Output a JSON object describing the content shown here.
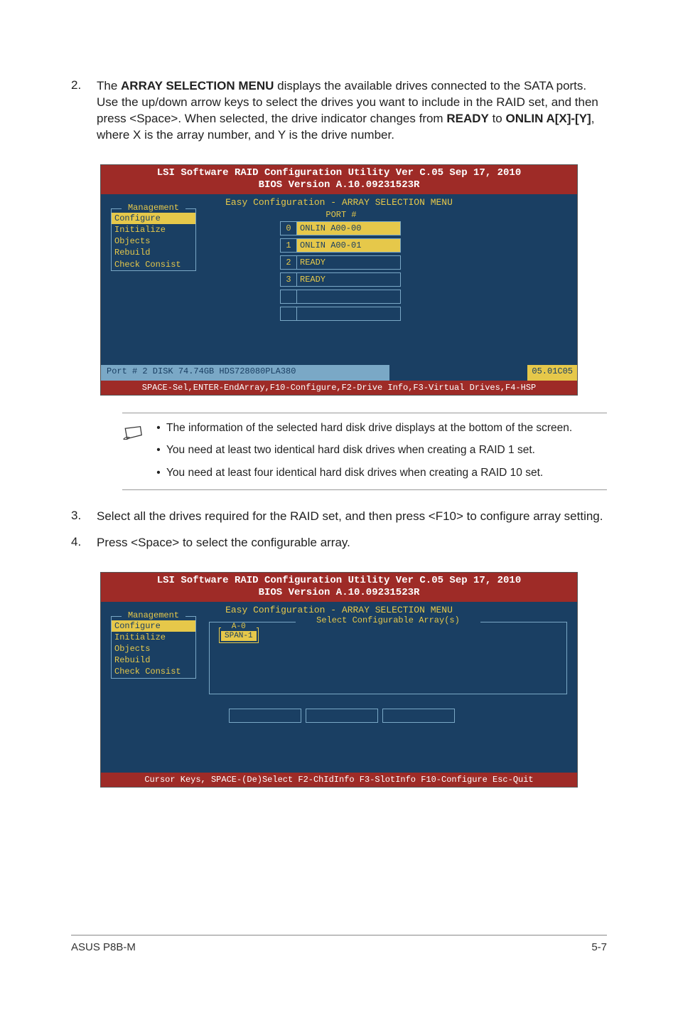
{
  "step2": {
    "num": "2.",
    "text_pre": "The ",
    "bold1": "ARRAY SELECTION MENU",
    "text_mid": " displays the available drives connected to the SATA ports. Use the up/down arrow keys to select the drives you want to include in the RAID set, and then press <Space>. When selected, the drive indicator changes from ",
    "bold2": "READY",
    "text_to": " to ",
    "bold3": "ONLIN A[X]-[Y]",
    "text_post": ", where X is the array number, and Y is the drive number."
  },
  "bios1": {
    "title_l1": "LSI Software RAID Configuration Utility Ver C.05 Sep 17, 2010",
    "title_l2": "BIOS Version   A.10.09231523R",
    "panel_title": "Easy Configuration - ARRAY SELECTION MENU",
    "mgmt_title": "Management",
    "mgmt_items": [
      "Configure",
      "Initialize",
      "Objects",
      "Rebuild",
      "Check Consist"
    ],
    "port_header": "PORT #",
    "ports": [
      {
        "idx": "0",
        "val": "ONLIN A00-00",
        "inverse": true
      },
      {
        "idx": "1",
        "val": "ONLIN A00-01",
        "inverse": true
      },
      {
        "idx": "2",
        "val": "READY",
        "inverse": false
      },
      {
        "idx": "3",
        "val": "READY",
        "inverse": false
      },
      {
        "idx": "",
        "val": "",
        "inverse": false
      },
      {
        "idx": "",
        "val": "",
        "inverse": false
      }
    ],
    "status_left": "Port # 2 DISK   74.74GB   HDS728080PLA380",
    "status_right": "05.01C05",
    "help": "SPACE-Sel,ENTER-EndArray,F10-Configure,F2-Drive Info,F3-Virtual Drives,F4-HSP"
  },
  "notes": {
    "n1": "The information of the selected hard disk drive displays at the bottom of the screen.",
    "n2": "You need at least two identical hard disk drives when creating a RAID 1 set.",
    "n3": "You need at least four identical hard disk drives when creating a RAID 10 set."
  },
  "step3": {
    "num": "3.",
    "text": "Select all the drives required for the RAID set, and then press <F10> to configure array setting."
  },
  "step4": {
    "num": "4.",
    "text": "Press <Space> to select the configurable array."
  },
  "bios2": {
    "title_l1": "LSI Software RAID Configuration Utility Ver C.05 Sep 17, 2010",
    "title_l2": "BIOS Version   A.10.09231523R",
    "panel_title": "Easy Configuration - ARRAY SELECTION MENU",
    "select_title": "Select Configurable Array(s)",
    "mgmt_title": "Management",
    "mgmt_items": [
      "Configure",
      "Initialize",
      "Objects",
      "Rebuild",
      "Check Consist"
    ],
    "span_title": "A-0",
    "span_val": "SPAN-1",
    "help": "Cursor Keys, SPACE-(De)Select F2-ChIdInfo F3-SlotInfo F10-Configure Esc-Quit"
  },
  "footer": {
    "left": "ASUS P8B-M",
    "right": "5-7"
  }
}
